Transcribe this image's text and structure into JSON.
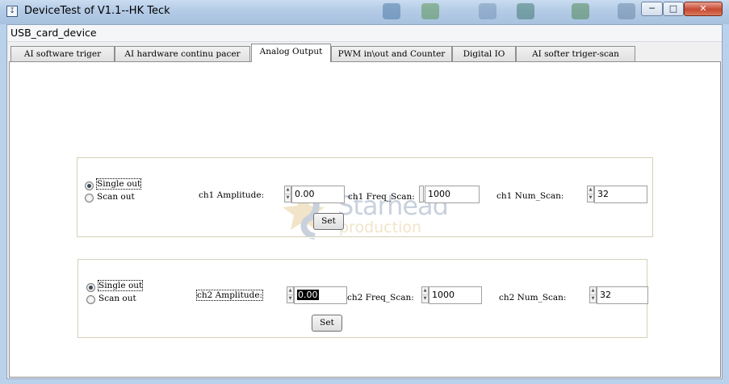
{
  "window": {
    "title": "DeviceTest of V1.1--HK Teck",
    "minimize_glyph": "─",
    "maximize_glyph": "□",
    "close_glyph": "✕"
  },
  "menubar": {
    "item": "USB_card_device"
  },
  "tabs": [
    {
      "label": "AI software triger"
    },
    {
      "label": "AI hardware continu pacer"
    },
    {
      "label": "Analog Output",
      "active": true
    },
    {
      "label": "PWM in\\out and Counter"
    },
    {
      "label": "Digital IO"
    },
    {
      "label": "AI softer triger-scan"
    }
  ],
  "ch1": {
    "mode_options": [
      "Single out",
      "Scan out"
    ],
    "selected_mode": "Single out",
    "amplitude_label": "ch1 Amplitude:",
    "amplitude_value": "0.00",
    "freq_label": "ch1 Freq_Scan:",
    "freq_value": "1000",
    "num_label": "ch1 Num_Scan:",
    "num_value": "32",
    "set_button": "Set"
  },
  "ch2": {
    "mode_options": [
      "Single out",
      "Scan out"
    ],
    "selected_mode": "Single out",
    "amplitude_label": "ch2 Amplitude:",
    "amplitude_value": "0.00",
    "freq_label": "ch2 Freq_Scan:",
    "freq_value": "1000",
    "num_label": "ch2 Num_Scan:",
    "num_value": "32",
    "set_button": "Set"
  },
  "watermark": {
    "main": "Starhead",
    "sub": "production"
  },
  "icons": {
    "app": "app-icon",
    "spinner_up": "▲",
    "spinner_down": "▼"
  },
  "colors": {
    "titlebar": "#b4cbe6",
    "close_button": "#c54a32",
    "group_border": "#d5d0b8",
    "watermark_blue": "#8a9bb6",
    "watermark_orange": "#e2c48a"
  }
}
